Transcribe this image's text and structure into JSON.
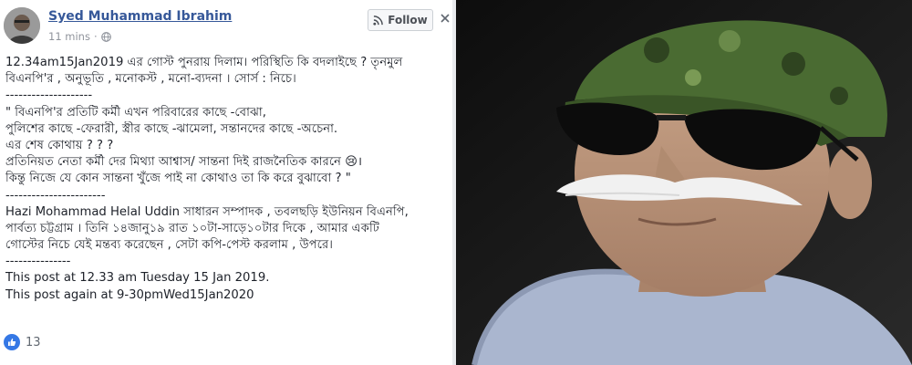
{
  "post": {
    "author": "Syed Muhammad Ibrahim",
    "time": "11 mins",
    "follow_label": "Follow",
    "lines": [
      "12.34am15Jan2019 এর গোস্ট পুনরায় দিলাম। পরিস্থিতি কি বদলাইছে ? তৃনমুল",
      "বিএনপি'র , অনুভূতি , মনোকস্ট , মনো-ব্যদনা । সোর্স : নিচে।",
      "--------------------",
      "\" বিএনপি'র প্রতিটি কর্মী এখন পরিবারের কাছে -বোঝা,",
      "পুলিশের কাছে -ফেরারী, স্ত্রীর কাছে -ঝামেলা, সন্তানদের কাছে -অচেনা.",
      "এর শেষ কোথায় ? ? ?",
      "প্রতিনিয়ত নেতা কর্মী দের মিথ্যা আশ্বাস/ সান্তনা দিই রাজনৈতিক কারনে 😢।",
      "কিন্তু নিজে যে কোন সান্তনা খুঁজে পাই না কোথাও তা কি করে বুঝাবো ? \"",
      "-----------------------",
      "Hazi Mohammad Helal Uddin সাধারন সম্পাদক , তবলছড়ি ইউনিয়ন বিএনপি,",
      "পার্বত্য চট্টগ্রাম । তিনি ১৪জানু১৯ রাত ১০টা-সাড়ে১০টার দিকে , আমার একটি",
      "গোস্টের নিচে যেই মন্তব্য করেছেন , সেটা কপি-পেস্ট করলাম , উপরে।",
      "---------------",
      "This post at 12.33 am Tuesday 15 Jan 2019.",
      "This post again at 9-30pmWed15Jan2020"
    ],
    "reaction_count": "13"
  },
  "icons": {
    "privacy": "globe-icon",
    "follow": "rss-icon",
    "close": "close-icon",
    "like": "like-icon"
  },
  "colors": {
    "author_link": "#365899",
    "meta_gray": "#90949c",
    "like_blue": "#3578e5",
    "cap_green": "#4a6b32"
  }
}
